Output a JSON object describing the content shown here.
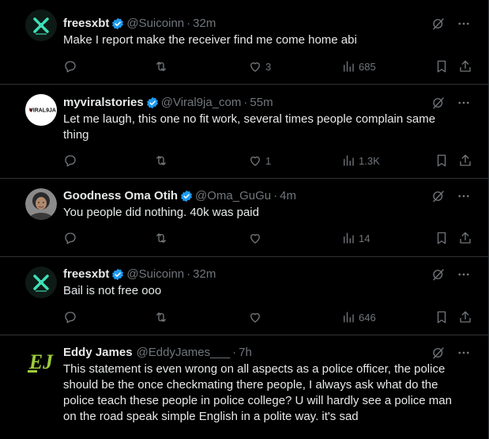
{
  "tweets": [
    {
      "name": "freesxbt",
      "handle": "@Suicoinn",
      "time": "32m",
      "text": "Make I report make the receiver find me come home abi",
      "likes": "3",
      "views": "685",
      "avatar": "freesxbt-logo"
    },
    {
      "name": "myviralstories",
      "handle": "@Viral9ja_com",
      "time": "55m",
      "text": "Let me laugh, this one no fit work, several times people complain same thing",
      "likes": "1",
      "views": "1.3K",
      "avatar": "viral9ja-logo",
      "avatar_text": "VIRAL9JA"
    },
    {
      "name": "Goodness Oma Otih",
      "handle": "@Oma_GuGu",
      "time": "4m",
      "text": "You people did nothing. 40k was paid",
      "likes": "",
      "views": "14",
      "avatar": "profile-photo"
    },
    {
      "name": "freesxbt",
      "handle": "@Suicoinn",
      "time": "32m",
      "text": "Bail is not free ooo",
      "likes": "",
      "views": "646",
      "avatar": "freesxbt-logo"
    },
    {
      "name": "Eddy James",
      "handle": "@EddyJames___",
      "time": "7h",
      "text": "This statement is even wrong on all aspects as a police officer, the police should be the once checkmating there people, I always ask what do the police teach these people in police college? U will hardly see a police man on the road speak simple English in a polite way. it's sad",
      "avatar": "ej-logo",
      "avatar_text": "EJ"
    }
  ],
  "separator": "·",
  "colors": {
    "background": "#000000",
    "text": "#e7e9ea",
    "muted": "#71767b",
    "verified": "#1d9bf0",
    "divider": "#2f3336"
  }
}
